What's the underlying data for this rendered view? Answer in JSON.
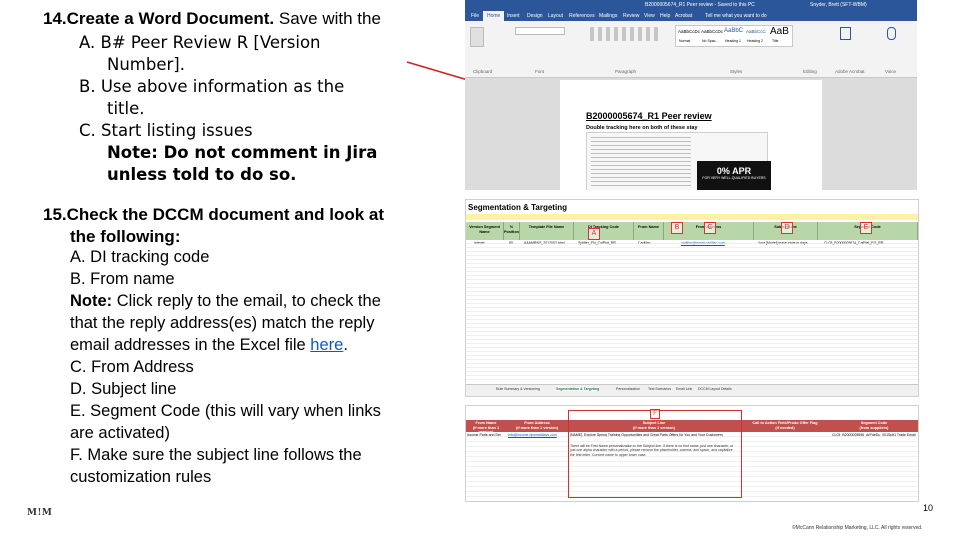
{
  "step14": {
    "number": "14.",
    "heading": "Create a Word Document.",
    "heading_rest": " Save with the",
    "items": [
      {
        "letter": "A.",
        "lines": [
          "B# Peer Review R [Version",
          "Number]."
        ]
      },
      {
        "letter": "B.",
        "lines": [
          "Use above information as the",
          "title."
        ]
      },
      {
        "letter": "C.",
        "lines": [
          "Start listing issues"
        ]
      }
    ],
    "note_lines": [
      "Note: Do not comment in Jira",
      "unless told to do so."
    ]
  },
  "step15": {
    "number": "15.",
    "heading_lines": [
      "Check the DCCM document and look at",
      "the following:"
    ],
    "line_a": "A. DI tracking code",
    "line_b": "B. From name",
    "note_label": "Note:",
    "note_lines": [
      " Click reply to the email, to check the",
      "that the reply address(es) match the reply",
      "email addresses in the Excel file "
    ],
    "link_text": "here",
    "after_link": ".",
    "line_c": "C. From Address",
    "line_d": "D. Subject line",
    "line_e1": "E. Segment Code (this will vary when links",
    "line_e2": "are activated)",
    "line_f1": "F. Make sure the subject line follows the",
    "line_f2": "customization rules"
  },
  "word_screenshot": {
    "title_bar": "B2000005674_R1 Peer review - Saved to this PC",
    "user": "Snyder, Brett (SFT-WBM)",
    "tabs": [
      "File",
      "Home",
      "Insert",
      "Design",
      "Layout",
      "References",
      "Mailings",
      "Review",
      "View",
      "Help",
      "Acrobat"
    ],
    "tell_me": "Tell me what you want to do",
    "groups": [
      "Clipboard",
      "Font",
      "Paragraph",
      "Styles",
      "Editing",
      "Adobe Acrobat",
      "Voice"
    ],
    "styles": [
      "AaBbCcDc",
      "AaBbCcDc",
      "AaBbC",
      "AaBbCcC",
      "AaB"
    ],
    "style_names": [
      "Normal",
      "No Spac...",
      "Heading 1",
      "Heading 2",
      "Title"
    ],
    "doc_title": "B2000005674_R1 Peer review",
    "doc_subtitle": "Double tracking here on both of these stay",
    "promo_big": "0% APR",
    "promo_small": "FOR VERY WELL-QUALIFIED BUYERS"
  },
  "excel_screenshot": {
    "title": "Segmentation & Targeting",
    "headers": [
      "Version Segment Name",
      "% Position",
      "Template File Name",
      "DI Tracking Code",
      "From Name",
      "From Address",
      "Subject Line",
      "Segment Code"
    ],
    "row": [
      "Inlenet",
      "80",
      "AAAMRNS_2012003.html",
      "Splitter_EN_CalPlat_RR",
      "Cadillac",
      "cadillac@email.cadillac.com",
      "Your [Model] lease ends in days",
      "CL03_B2000005674_CalPlat_EO_RR"
    ],
    "sheet_tabs": [
      "Rule Summary & Versioning",
      "Segmentation & Targeting",
      "Personalization",
      "Test Scenarios",
      "Email Link",
      "DCCM Layout Details"
    ],
    "markers": [
      "A",
      "B",
      "C",
      "D",
      "E"
    ]
  },
  "excel_crop": {
    "headers": [
      "From Name",
      "From Address",
      "Subject Line",
      "Call to Action Field/Prodo Offer Flag",
      "Segment Code"
    ],
    "header_notes": [
      "(if more than 1 version)",
      "(if more than 1 version)",
      "(if more than 1 version)",
      "(if needed)",
      "(from suppliers)"
    ],
    "row": [
      "Income Parts and Ser",
      "info@income.dpsmaltdays.com",
      "[NAME], Explore Spring Training Opportunities and Great Parts Offers for You and Your Customers",
      "",
      "CL03_B2000005596_ArPdeDu_001Splt1 Trade Email"
    ],
    "paragraph": "There will be First Name personalization in the Subject line. If there is no first name, just one character, or just one alpha character with a period, please remove the placeholder, comma, and space, and capitalize the first letter. Convert name to upper lower case.",
    "marker": "F"
  },
  "footer": {
    "logo": "M!M",
    "page_number": "10",
    "copyright": "©McCann Relationship Marketing, LLC. All rights reserved."
  },
  "colors": {
    "word_blue": "#2b579a",
    "excel_green_header": "#b7d7a8",
    "red_header": "#c0504d",
    "annotation_red": "#e03030",
    "link_blue": "#1155cc"
  }
}
